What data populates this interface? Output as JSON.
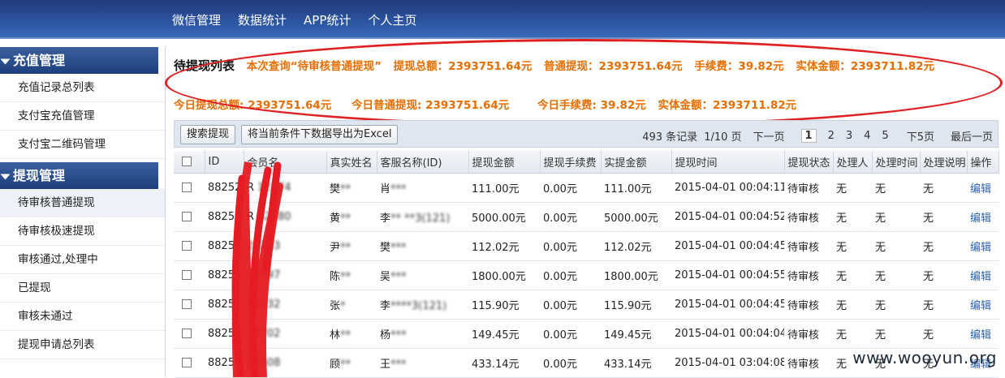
{
  "topnav": [
    "微信管理",
    "数据统计",
    "APP统计",
    "个人主页"
  ],
  "sidebar": {
    "sections": [
      {
        "title": "充值管理",
        "items": [
          "充值记录总列表",
          "支付宝充值管理",
          "支付宝二维码管理"
        ]
      },
      {
        "title": "提现管理",
        "items": [
          "待审核普通提现",
          "待审核极速提现",
          "审核通过,处理中",
          "已提现",
          "审核未通过",
          "提现申请总列表"
        ]
      }
    ]
  },
  "summary": {
    "title": "待提现列表",
    "query": "本次查询“待审核普通提现”",
    "total": "提现总额：2393751.64元",
    "normal": "普通提现：2393751.64元",
    "fee": "手续费：39.82元",
    "actual": "实体金额：2393711.82元",
    "today_total": "今日提现总额: 2393751.64元",
    "today_normal": "今日普通提现: 2393751.64元",
    "today_fee": "今日手续费: 39.82元",
    "today_actual": "实体金额：2393711.82元"
  },
  "toolbar": {
    "search_btn": "搜索提现",
    "export_btn": "将当前条件下数据导出为Excel",
    "records": "493 条记录",
    "page_info": "1/10 页",
    "next": "下一页",
    "pages": [
      "1",
      "2",
      "3",
      "4",
      "5"
    ],
    "next5": "下5页",
    "last": "最后一页"
  },
  "table": {
    "headers": [
      "",
      "ID",
      "会员名",
      "真实姓名",
      "客服名称(ID)",
      "提现金额",
      "提现手续费",
      "实提金额",
      "提现时间",
      "提现状态",
      "处理人",
      "处理时间",
      "处理说明",
      "操作"
    ],
    "rows": [
      {
        "id": "88252",
        "member": "R   12274",
        "real": "樊**",
        "service": "肖***",
        "amount": "111.00元",
        "fee": "0.00元",
        "actual": "111.00元",
        "time": "2015-04-01 00:04:11",
        "status": "待审核",
        "handler": "无",
        "htime": "无",
        "note": "无",
        "op": "编辑"
      },
      {
        "id": "88253",
        "member": "R   62580",
        "real": "黄**",
        "service": "李** **3(121)",
        "amount": "5000.00元",
        "fee": "0.00元",
        "actual": "5000.00元",
        "time": "2015-04-01 00:04:52",
        "status": "待审核",
        "handler": "无",
        "htime": "无",
        "note": "无",
        "op": "编辑"
      },
      {
        "id": "88254",
        "member": "    25283",
        "real": "尹**",
        "service": "樊***",
        "amount": "112.02元",
        "fee": "0.00元",
        "actual": "112.02元",
        "time": "2015-04-01 00:04:45",
        "status": "待审核",
        "handler": "无",
        "htime": "无",
        "note": "无",
        "op": "编辑"
      },
      {
        "id": "88255",
        "member": "    00997",
        "real": "陈**",
        "service": "吴***",
        "amount": "1800.00元",
        "fee": "0.00元",
        "actual": "1800.00元",
        "time": "2015-04-01 00:04:55",
        "status": "待审核",
        "handler": "无",
        "htime": "无",
        "note": "无",
        "op": "编辑"
      },
      {
        "id": "8825",
        "member": "    60832",
        "real": "张*",
        "service": "李****3(121)",
        "amount": "115.90元",
        "fee": "0.00元",
        "actual": "115.90元",
        "time": "2015-04-01 00:04:45",
        "status": "待审核",
        "handler": "无",
        "htime": "无",
        "note": "无",
        "op": "编辑"
      },
      {
        "id": "8825",
        "member": "    32702",
        "real": "林**",
        "service": "杨***",
        "amount": "149.45元",
        "fee": "0.00元",
        "actual": "149.45元",
        "time": "2015-04-01 00:04:04",
        "status": "待审核",
        "handler": "无",
        "htime": "无",
        "note": "无",
        "op": "编辑"
      },
      {
        "id": "8825",
        "member": "    77608",
        "real": "顾**",
        "service": "王***",
        "amount": "433.14元",
        "fee": "0.00元",
        "actual": "433.14元",
        "time": "2015-04-01 03:04:08",
        "status": "待审核",
        "handler": "无",
        "htime": "无",
        "note": "无",
        "op": "编辑"
      }
    ]
  },
  "watermark": "www.wooyun.org",
  "colors": {
    "accent_orange": "#e86d00",
    "header_blue": "#2f5aa8",
    "annotation_red": "#e02020",
    "link_blue": "#2a5fb0"
  }
}
